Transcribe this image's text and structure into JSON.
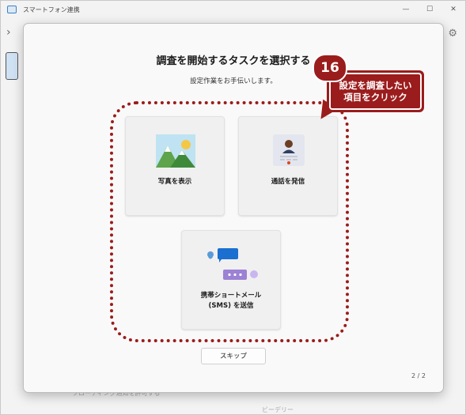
{
  "app": {
    "title": "スマートフォン連携",
    "minimize": "—",
    "maximize": "☐",
    "close": "✕"
  },
  "dialog": {
    "title": "調査を開始するタスクを選択する",
    "subtitle": "設定作業をお手伝いします。",
    "cards": {
      "photos": "写真を表示",
      "calls": "通話を発信",
      "sms_line1": "携帯ショートメール",
      "sms_line2": "(SMS) を送信"
    },
    "skip_label": "スキップ",
    "page_indicator": "2 / 2"
  },
  "annotation": {
    "step_number": "16",
    "callout_line1": "設定を調査したい",
    "callout_line2": "項目をクリック",
    "color": "#9b1c1c"
  },
  "background": {
    "text1": "ブローティング通知を許可する",
    "text2": "ビーデリー"
  }
}
